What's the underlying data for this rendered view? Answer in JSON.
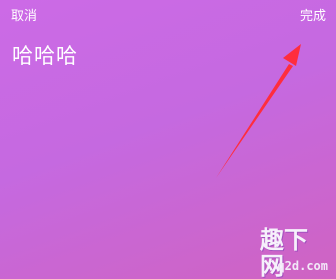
{
  "topbar": {
    "cancel_label": "取消",
    "done_label": "完成"
  },
  "note": {
    "text": "哈哈哈"
  },
  "annotation": {
    "arrow_color": "#ff2d3d",
    "arrow_icon": "red-arrow-annotation"
  },
  "watermark": {
    "brand": "趣下网",
    "domain": "q2d.com"
  },
  "theme": {
    "background_start": "#cc6ae6",
    "background_end": "#cf63c2",
    "text_color": "#ffffff"
  }
}
